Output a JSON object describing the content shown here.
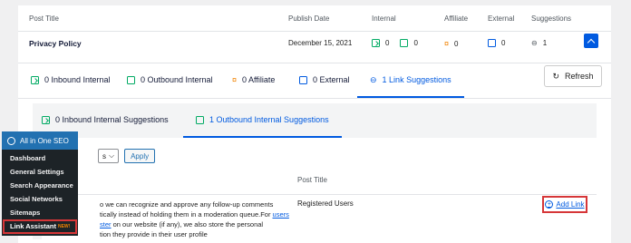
{
  "table": {
    "headers": [
      "Post Title",
      "Publish Date",
      "Internal",
      "Affiliate",
      "External",
      "Suggestions"
    ],
    "row": {
      "title": "Privacy Policy",
      "date": "December 15, 2021",
      "internal_in": "0",
      "internal_out": "0",
      "affiliate": "0",
      "external": "0",
      "suggestions": "1"
    }
  },
  "tabs": [
    {
      "label": "0 Inbound Internal",
      "icon": "inbound-icon"
    },
    {
      "label": "0 Outbound Internal",
      "icon": "outbound-icon"
    },
    {
      "label": "0 Affiliate",
      "icon": "affiliate-icon"
    },
    {
      "label": "0 External",
      "icon": "external-icon"
    },
    {
      "label": "1 Link Suggestions",
      "icon": "link-icon",
      "active": true
    }
  ],
  "refresh_label": "Refresh",
  "subtabs": [
    {
      "label": "0 Inbound Internal Suggestions"
    },
    {
      "label": "1 Outbound Internal Suggestions",
      "active": true
    }
  ],
  "bulk": {
    "select_value": "s",
    "apply_label": "Apply"
  },
  "suggestion_table": {
    "post_title_header": "Post Title",
    "text_line1": "o we can recognize and approve any follow-up comments",
    "text_line2a": "tically instead of holding them in a moderation queue.For ",
    "text_link1": "users",
    "text_line3_link": "ster",
    "text_line3b": " on our website (if any), we also store the personal",
    "text_line4": "tion they provide in their user profile",
    "post_title": "Registered Users",
    "add_link_label": "Add Link"
  },
  "menu": {
    "title": "All in One SEO",
    "items": [
      "Dashboard",
      "General Settings",
      "Search Appearance",
      "Social Networks",
      "Sitemaps"
    ],
    "highlight": "Link Assistant",
    "badge": "NEW!"
  },
  "colors": {
    "accent": "#005ae0",
    "highlight": "#d63638",
    "sidebar": "#1d2327",
    "menu_head": "#2271b1"
  }
}
